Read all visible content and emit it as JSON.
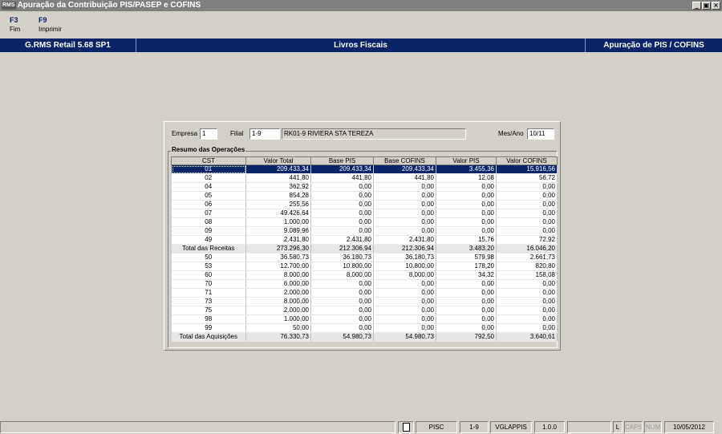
{
  "window": {
    "icon_text": "RMS",
    "title": "Apuração da Contribuição PIS/PASEP e COFINS",
    "buttons": [
      "_",
      "▣",
      "×"
    ]
  },
  "toolbar": [
    {
      "key": "F3",
      "label": "Fim"
    },
    {
      "key": "F9",
      "label": "Imprimir"
    }
  ],
  "header": {
    "left": "G.RMS Retail 5.68 SP1",
    "center": "Livros Fiscais",
    "right": "Apuração de PIS / COFINS"
  },
  "filters": {
    "empresa_label": "Empresa",
    "empresa_value": "1",
    "filial_label": "Filial",
    "filial_value": "1-9",
    "filial_name": "RK01-9 RIVIERA STA TEREZA",
    "mes_ano_label": "Mes/Ano",
    "mes_ano_value": "10/11"
  },
  "summary": {
    "title": "Resumo das Operações",
    "columns": [
      "CST",
      "Valor Total",
      "Base PIS",
      "Base COFINS",
      "Valor PIS",
      "Valor COFINS"
    ],
    "rows": [
      [
        "01",
        "209.433,34",
        "209.433,34",
        "209.433,34",
        "3.455,36",
        "15.916,56"
      ],
      [
        "02",
        "441,80",
        "441,80",
        "441,80",
        "12,08",
        "56,72"
      ],
      [
        "04",
        "362,92",
        "0,00",
        "0,00",
        "0,00",
        "0,00"
      ],
      [
        "05",
        "854,28",
        "0,00",
        "0,00",
        "0,00",
        "0,00"
      ],
      [
        "06",
        "255,56",
        "0,00",
        "0,00",
        "0,00",
        "0,00"
      ],
      [
        "07",
        "49.426,64",
        "0,00",
        "0,00",
        "0,00",
        "0,00"
      ],
      [
        "08",
        "1.000,00",
        "0,00",
        "0,00",
        "0,00",
        "0,00"
      ],
      [
        "09",
        "9.089,96",
        "0,00",
        "0,00",
        "0,00",
        "0,00"
      ],
      [
        "49",
        "2.431,80",
        "2.431,80",
        "2.431,80",
        "15,76",
        "72,92"
      ],
      [
        "Total das Receitas",
        "273.296,30",
        "212.306,94",
        "212.306,94",
        "3.483,20",
        "16.046,20"
      ],
      [
        "50",
        "36.580,73",
        "36.180,73",
        "36.180,73",
        "579,98",
        "2.661,73"
      ],
      [
        "53",
        "12.700,00",
        "10.800,00",
        "10.800,00",
        "178,20",
        "820,80"
      ],
      [
        "60",
        "8.000,00",
        "8.000,00",
        "8.000,00",
        "34,32",
        "158,08"
      ],
      [
        "70",
        "6.000,00",
        "0,00",
        "0,00",
        "0,00",
        "0,00"
      ],
      [
        "71",
        "2.000,00",
        "0,00",
        "0,00",
        "0,00",
        "0,00"
      ],
      [
        "73",
        "8.000,00",
        "0,00",
        "0,00",
        "0,00",
        "0,00"
      ],
      [
        "75",
        "2.000,00",
        "0,00",
        "0,00",
        "0,00",
        "0,00"
      ],
      [
        "98",
        "1.000,00",
        "0,00",
        "0,00",
        "0,00",
        "0,00"
      ],
      [
        "99",
        "50,00",
        "0,00",
        "0,00",
        "0,00",
        "0,00"
      ],
      [
        "Total das Aquisições",
        "76.330,73",
        "54.980,73",
        "54.980,73",
        "792,50",
        "3.640,61"
      ]
    ]
  },
  "statusbar": {
    "module": "PISC",
    "filial": "1-9",
    "server": "VGLAPPIS",
    "version": "1.0.0",
    "l": "L",
    "caps": "CAPS",
    "num": "NUM",
    "date": "10/05/2012"
  }
}
